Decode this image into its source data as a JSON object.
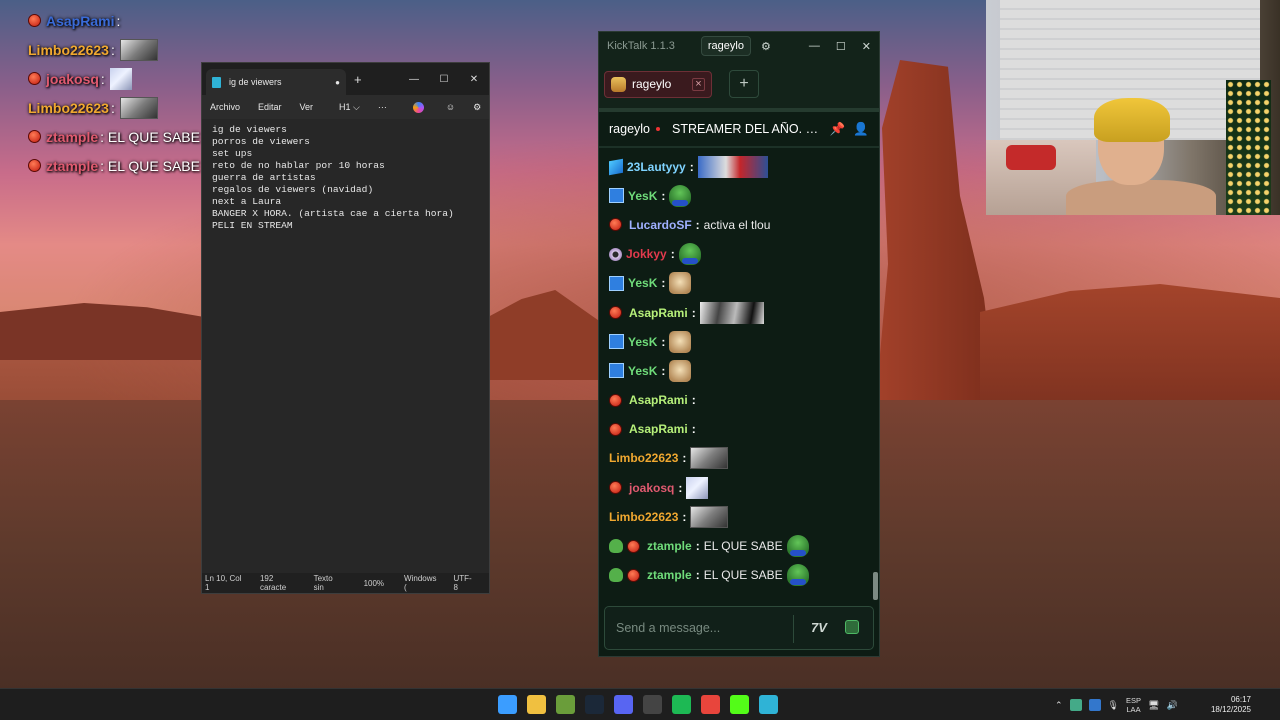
{
  "overlay": {
    "lines": [
      {
        "user": "AsapRami",
        "color": "#3a6bd8",
        "suffix": ":",
        "emote": "none"
      },
      {
        "user": "Limbo22623",
        "color": "#f0a830",
        "suffix": ":",
        "emote": "face"
      },
      {
        "user": "joakosq",
        "color": "#e05a70",
        "suffix": ":",
        "emote": "face2"
      },
      {
        "user": "Limbo22623",
        "color": "#f0a830",
        "suffix": ":",
        "emote": "face"
      },
      {
        "user": "ztample",
        "color": "#e05a70",
        "suffix": ": EL QUE SABE",
        "emote": "pepe"
      },
      {
        "user": "ztample",
        "color": "#e05a70",
        "suffix": ": EL QUE SABE",
        "emote": "pepe"
      }
    ]
  },
  "notepad": {
    "tab_title": "ig de viewers",
    "menu": [
      "Archivo",
      "Editar",
      "Ver",
      "H1 ⌵",
      "···"
    ],
    "lines": [
      "ig de viewers",
      "porros de viewers",
      "set ups",
      "reto de no hablar por 10 horas",
      "guerra de artistas",
      "regalos de viewers (navidad)",
      "next a Laura",
      "BANGER X HORA. (artista cae a cierta hora)",
      "PELI EN STREAM"
    ],
    "status": {
      "pos": "Ln 10, Col 1",
      "chars": "192 caracte",
      "format": "Texto sin",
      "zoom": "100%",
      "eol": "Windows (",
      "enc": "UTF-8"
    }
  },
  "kicktalk": {
    "app_title": "KickTalk 1.1.3",
    "channel_btn": "rageylo",
    "tab_label": "rageylo",
    "stream_user": "rageylo",
    "stream_title": "STREAMER DEL AÑO. G...",
    "input_placeholder": "Send a message...",
    "messages": [
      {
        "user": "23Lautyyy",
        "color": "#7fd3ff",
        "badge": "cube",
        "text": "",
        "emote": "santa"
      },
      {
        "user": "YesK",
        "color": "#6fdc7a",
        "badge": "blue",
        "text": "",
        "emote": "pepe"
      },
      {
        "user": "LucardoSF",
        "color": "#9fb0ff",
        "badge": "kick",
        "text": "activa el tlou",
        "emote": "none"
      },
      {
        "user": "Jokkyy",
        "color": "#e23a4d",
        "badge": "pink",
        "text": "",
        "emote": "pepe"
      },
      {
        "user": "YesK",
        "color": "#6fdc7a",
        "badge": "blue",
        "text": "",
        "emote": "cat"
      },
      {
        "user": "AsapRami",
        "color": "#b6f07a",
        "badge": "kick",
        "text": "",
        "emote": "bw"
      },
      {
        "user": "YesK",
        "color": "#6fdc7a",
        "badge": "blue",
        "text": "",
        "emote": "cat"
      },
      {
        "user": "YesK",
        "color": "#6fdc7a",
        "badge": "blue",
        "text": "",
        "emote": "cat"
      },
      {
        "user": "AsapRami",
        "color": "#b6f07a",
        "badge": "kick",
        "text": "",
        "emote": "none"
      },
      {
        "user": "AsapRami",
        "color": "#b6f07a",
        "badge": "kick",
        "text": "",
        "emote": "none"
      },
      {
        "user": "Limbo22623",
        "color": "#f0a830",
        "badge": "none",
        "text": "",
        "emote": "face"
      },
      {
        "user": "joakosq",
        "color": "#e05a70",
        "badge": "kick",
        "text": "",
        "emote": "face2"
      },
      {
        "user": "Limbo22623",
        "color": "#f0a830",
        "badge": "none",
        "text": "",
        "emote": "face"
      },
      {
        "user": "ztample",
        "color": "#6fdc7a",
        "badge": "frogkick",
        "text": "EL QUE SABE",
        "emote": "pepe"
      },
      {
        "user": "ztample",
        "color": "#6fdc7a",
        "badge": "frogkick",
        "text": "EL QUE SABE",
        "emote": "pepe"
      }
    ]
  },
  "taskbar": {
    "apps": [
      {
        "name": "windows-start-icon",
        "color": "#3b9dff"
      },
      {
        "name": "file-explorer-icon",
        "color": "#f0c040"
      },
      {
        "name": "minecraft-icon",
        "color": "#6a9d3a"
      },
      {
        "name": "steam-icon",
        "color": "#1b2838"
      },
      {
        "name": "discord-icon",
        "color": "#5865f2"
      },
      {
        "name": "obs-icon",
        "color": "#444444"
      },
      {
        "name": "spotify-icon",
        "color": "#1db954"
      },
      {
        "name": "chrome-icon",
        "color": "#e8453c"
      },
      {
        "name": "kick-icon",
        "color": "#53fc18"
      },
      {
        "name": "notepad-icon",
        "color": "#2fb3d6"
      }
    ],
    "lang_top": "ESP",
    "lang_bottom": "LAA",
    "time": "06:17",
    "date": "18/12/2025"
  }
}
